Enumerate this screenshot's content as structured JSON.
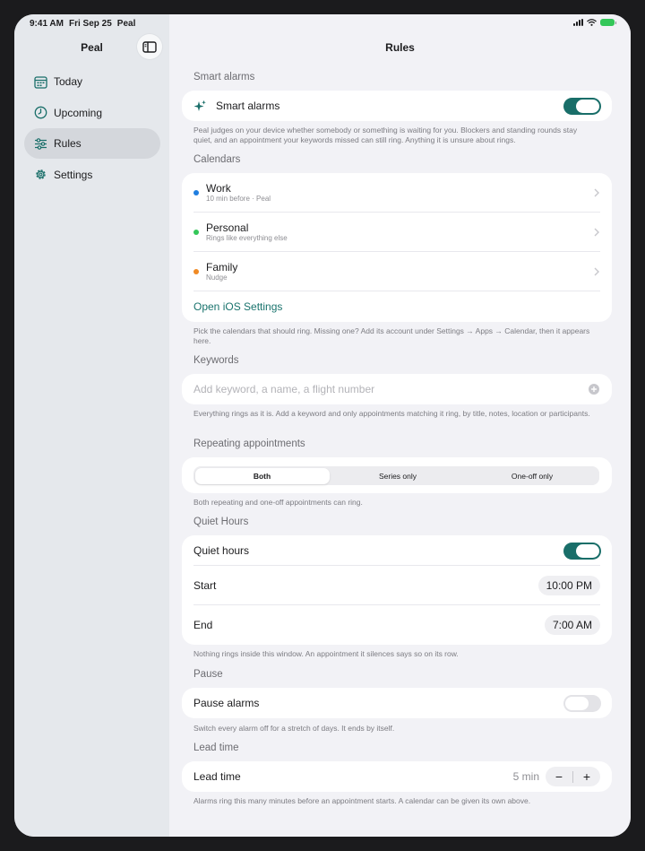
{
  "status": {
    "time": "9:41 AM",
    "date": "Fri Sep 25",
    "app": "Peal"
  },
  "sidebar": {
    "title": "Peal",
    "items": [
      {
        "label": "Today",
        "icon": "calendar-icon"
      },
      {
        "label": "Upcoming",
        "icon": "clock-icon"
      },
      {
        "label": "Rules",
        "icon": "sliders-icon",
        "selected": true
      },
      {
        "label": "Settings",
        "icon": "gear-icon"
      }
    ]
  },
  "main": {
    "title": "Rules",
    "smart_alarms": {
      "header": "Smart alarms",
      "label": "Smart alarms",
      "on": true,
      "footer": "Peal judges on your device whether somebody or something is waiting for you. Blockers and standing rounds stay quiet, and an appointment your keywords missed can still ring. Anything it is unsure about rings."
    },
    "calendars": {
      "header": "Calendars",
      "items": [
        {
          "name": "Work",
          "detail": "10 min before · Peal",
          "color": "#1f7ee0"
        },
        {
          "name": "Personal",
          "detail": "Rings like everything else",
          "color": "#34c759"
        },
        {
          "name": "Family",
          "detail": "Nudge",
          "color": "#f08a24"
        }
      ],
      "link": "Open iOS Settings",
      "footer": "Pick the calendars that should ring. Missing one? Add its account under Settings → Apps → Calendar, then it appears here."
    },
    "keywords": {
      "header": "Keywords",
      "placeholder": "Add keyword, a name, a flight number",
      "value": "",
      "footer": "Everything rings as it is. Add a keyword and only appointments matching it ring, by title, notes, location or participants."
    },
    "repeating": {
      "header": "Repeating appointments",
      "options": [
        "Both",
        "Series only",
        "One-off only"
      ],
      "selected": "Both",
      "footer": "Both repeating and one-off appointments can ring."
    },
    "quiet_hours": {
      "header": "Quiet Hours",
      "label": "Quiet hours",
      "on": true,
      "start_label": "Start",
      "start_value": "10:00 PM",
      "end_label": "End",
      "end_value": "7:00 AM",
      "footer": "Nothing rings inside this window. An appointment it silences says so on its row."
    },
    "pause": {
      "header": "Pause",
      "label": "Pause alarms",
      "on": false,
      "footer": "Switch every alarm off for a stretch of days. It ends by itself."
    },
    "lead_time": {
      "header": "Lead time",
      "label": "Lead time",
      "value": "5 min",
      "minus": "−",
      "plus": "+",
      "footer": "Alarms ring this many minutes before an appointment starts. A calendar can be given its own above."
    },
    "colors": {
      "accent": "#196e69",
      "link": "#19736d",
      "sidebar_bg": "#e5e8ec",
      "page_bg": "#f2f2f6"
    }
  }
}
